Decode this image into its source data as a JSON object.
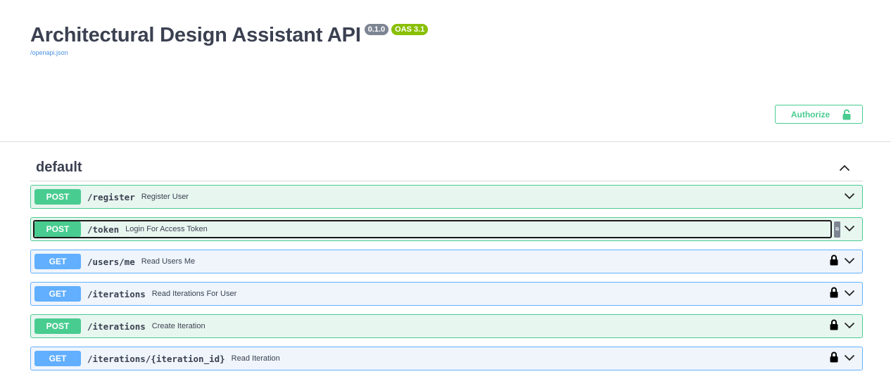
{
  "info": {
    "title": "Architectural Design Assistant API",
    "version": "0.1.0",
    "oas": "OAS 3.1",
    "spec_url": "/openapi.json"
  },
  "authorize": {
    "label": "Authorize",
    "icon": "unlocked-icon"
  },
  "section": {
    "name": "default",
    "expanded": true
  },
  "operations": [
    {
      "method": "POST",
      "path": "/register",
      "summary": "Register User",
      "locked": false,
      "focused": false
    },
    {
      "method": "POST",
      "path": "/token",
      "summary": "Login For Access Token",
      "locked": false,
      "focused": true
    },
    {
      "method": "GET",
      "path": "/users/me",
      "summary": "Read Users Me",
      "locked": true,
      "focused": false
    },
    {
      "method": "GET",
      "path": "/iterations",
      "summary": "Read Iterations For User",
      "locked": true,
      "focused": false
    },
    {
      "method": "POST",
      "path": "/iterations",
      "summary": "Create Iteration",
      "locked": true,
      "focused": false
    },
    {
      "method": "GET",
      "path": "/iterations/{iteration_id}",
      "summary": "Read Iteration",
      "locked": true,
      "focused": false
    }
  ],
  "colors": {
    "post": "#49cc90",
    "get": "#61affe",
    "text": "#3b4151",
    "link": "#4990e2"
  }
}
